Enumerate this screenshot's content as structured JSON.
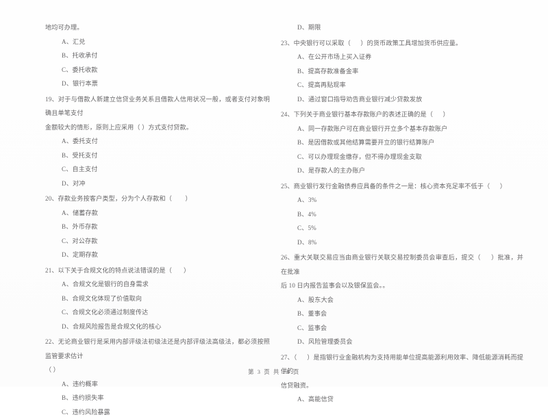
{
  "document": {
    "type": "exam-paper",
    "language": "zh-CN",
    "footer": "第 3 页 共 18 页"
  },
  "left_column": {
    "carryover": {
      "tail_line": "地均可办理。",
      "options": [
        "A、汇兑",
        "B、托收承付",
        "C、委托收款",
        "D、银行本票"
      ]
    },
    "questions": [
      {
        "number": "19",
        "stem_line1": "19、对于与借款人新建立信贷业务关系且借款人信用状况一般，或者支付对象明确且单笔支付",
        "stem_line2": "金额较大的情形，原则上应采用（      ）方式支付贷款。",
        "options": [
          "A、委托支付",
          "B、受托支付",
          "C、自主支付",
          "D、对冲"
        ]
      },
      {
        "number": "20",
        "stem_line1": "20、存款业务按客户类型，分为个人存款和（        ）",
        "stem_line2": "",
        "options": [
          "A、储蓄存款",
          "B、外币存款",
          "C、对公存款",
          "D、定期存款"
        ]
      },
      {
        "number": "21",
        "stem_line1": "21、以下关于合规文化的特点说法错误的是（       ）",
        "stem_line2": "",
        "options": [
          "A、合规文化是银行的自身需求",
          "B、合规文化体现了价值取向",
          "C、合规文化必须通过制度传达",
          "D、合规风险报告是合规文化的核心"
        ]
      },
      {
        "number": "22",
        "stem_line1": "22、无论商业银行是采用内部评级法初级法还是内部评级法高级法，都必须按照监管要求估计",
        "stem_line2": "（       ）",
        "options": [
          "A、违约概率",
          "B、违约损失率",
          "C、违约风险暴露"
        ]
      }
    ]
  },
  "right_column": {
    "carryover": {
      "options": [
        "D、期限"
      ]
    },
    "questions": [
      {
        "number": "23",
        "stem_line1": "23、中央银行可以采取（      ）的货币政策工具增加货币供应量。",
        "stem_line2": "",
        "options": [
          "A、在公开市场上买入证券",
          "B、提高存款准备金率",
          "C、提高再贴现率",
          "D、通过窗口指导劝告商业银行减少贷款发放"
        ]
      },
      {
        "number": "24",
        "stem_line1": "24、下列关于商业银行基本存款账户的表述正确的是（      ）",
        "stem_line2": "",
        "options": [
          "A、同一存款账户可在商业银行开立多个基本存款账户",
          "B、是因借款或其他结算需要开立的银行结算账户",
          "C、可以办理现金缴存，但不得办理现金支取",
          "D、是存款人的主办账户"
        ]
      },
      {
        "number": "25",
        "stem_line1": "25、商业银行发行金融债券应具备的条件之一是：核心资本充足率不低于（      ）",
        "stem_line2": "",
        "options": [
          "A、3%",
          "B、4%",
          "C、5%",
          "D、8%"
        ]
      },
      {
        "number": "26",
        "stem_line1": "26、重大关联交易应当由商业银行关联交易控制委员会审查后，提交（      ）批准，并在批准",
        "stem_line2": "后 10 日内报告监事会以及银保监会。。",
        "options": [
          "A、股东大会",
          "B、董事会",
          "C、监事会",
          "D、风险管理委员会"
        ]
      },
      {
        "number": "27",
        "stem_line1": "27、（      ）是指银行业金融机构为支持用能单位提高能源利用效率、降低能源消耗而提供的",
        "stem_line2": "信贷融资。",
        "options": [
          "A、高能信贷"
        ]
      }
    ]
  }
}
